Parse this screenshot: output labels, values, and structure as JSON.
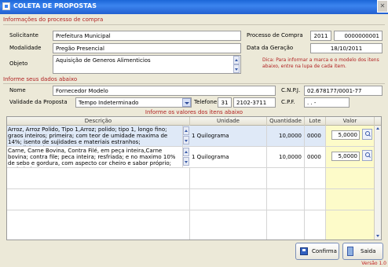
{
  "window": {
    "title": "COLETA DE PROPOSTAS"
  },
  "processo": {
    "section_title": "Informações do processo de compra",
    "solicitante_label": "Solicitante",
    "solicitante": "Prefeitura Municipal",
    "modalidade_label": "Modalidade",
    "modalidade": "Pregão Presencial",
    "objeto_label": "Objeto",
    "objeto": "Aquisição de Generos Alimenticios",
    "processo_label": "Processo de Compra",
    "processo_ano": "2011",
    "processo_numero": "0000000001",
    "data_geracao_label": "Data da Geração",
    "data_geracao": "18/10/2011",
    "dica": "Dica: Para informar a marca e o modelo dos itens abaixo, entre na lupa de cada item."
  },
  "dados": {
    "section_title": "Informe seus dados abaixo",
    "nome_label": "Nome",
    "nome": "Fornecedor Modelo",
    "cnpj_label": "C.N.P.J.",
    "cnpj": "02.678177/0001-77",
    "validade_label": "Validade da Proposta",
    "validade": "Tempo Indeterminado",
    "telefone_label": "Telefone",
    "ddd": "31",
    "telefone": "2102-3711",
    "cpf_label": "C.P.F.",
    "cpf": " .   .   -"
  },
  "itens": {
    "section_title": "Informe os valores dos itens abaixo",
    "columns": {
      "descricao": "Descrição",
      "unidade": "Unidade",
      "quantidade": "Quantidade",
      "lote": "Lote",
      "valor": "Valor"
    },
    "rows": [
      {
        "descricao": "Arroz, Arroz Polido, Tipo 1,Arroz; polido; tipo 1, longo fino; graos inteiros; primeira; com teor de umidade maxima de 14%; isento de sujidades e materiais estranhos; acondicionado em saco",
        "unidade": "1 Quilograma",
        "quantidade": "10,0000",
        "lote": "0000",
        "valor": "5,0000"
      },
      {
        "descricao": "Carne, Carne Bovina, Contra Filé, em peça inteira,Carne bovina; contra file; peca inteira; resfriada; e no maximo 10% de sebo e gordura, com aspecto cor cheiro e sabor próprio; embalada em",
        "unidade": "1 Quilograma",
        "quantidade": "10,0000",
        "lote": "0000",
        "valor": "5,0000"
      }
    ]
  },
  "buttons": {
    "confirma": "Confirma",
    "saida": "Saida"
  },
  "version": "Versão 1.0"
}
